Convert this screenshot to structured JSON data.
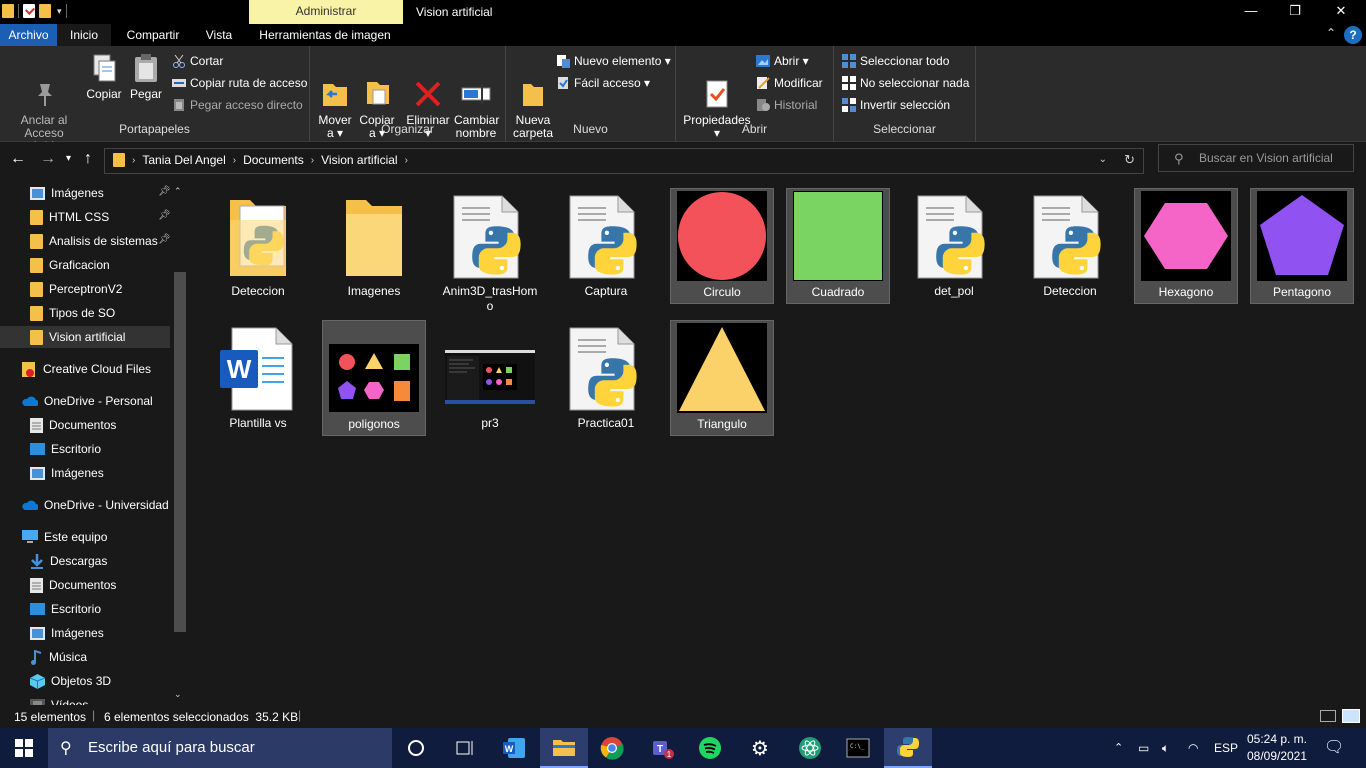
{
  "titlebar": {
    "context_tab": "Administrar",
    "window_title": "Vision artificial",
    "minimize": "—",
    "maximize": "❐",
    "close": "✕"
  },
  "ribbon_tabs": [
    "Archivo",
    "Inicio",
    "Compartir",
    "Vista",
    "Herramientas de imagen"
  ],
  "ribbon": {
    "portapapeles": {
      "label": "Portapapeles",
      "pin": "Anclar al\nAcceso rápido",
      "copy": "Copiar",
      "paste": "Pegar",
      "cut": "Cortar",
      "copy_path": "Copiar ruta de acceso",
      "paste_shortcut": "Pegar acceso directo"
    },
    "organizar": {
      "label": "Organizar",
      "move": "Mover\na ▾",
      "copy_to": "Copiar\na ▾",
      "delete": "Eliminar\n▾",
      "rename": "Cambiar\nnombre"
    },
    "nuevo": {
      "label": "Nuevo",
      "new_folder": "Nueva\ncarpeta",
      "new_item": "Nuevo elemento ▾",
      "easy_access": "Fácil acceso ▾"
    },
    "abrir": {
      "label": "Abrir",
      "properties": "Propiedades\n▾",
      "open": "Abrir ▾",
      "edit": "Modificar",
      "history": "Historial"
    },
    "seleccionar": {
      "label": "Seleccionar",
      "select_all": "Seleccionar todo",
      "select_none": "No seleccionar nada",
      "invert": "Invertir selección"
    }
  },
  "address": {
    "crumbs": [
      "Tania Del Angel",
      "Documents",
      "Vision artificial"
    ],
    "search_placeholder": "Buscar en Vision artificial"
  },
  "sidebar": [
    {
      "label": "Imágenes",
      "icon": "pictures-icon",
      "pinned": true
    },
    {
      "label": "HTML CSS",
      "icon": "folder-icon",
      "pinned": true
    },
    {
      "label": "Analisis de sistemas",
      "icon": "folder-icon",
      "pinned": true
    },
    {
      "label": "Graficacion",
      "icon": "folder-icon",
      "pinned": false
    },
    {
      "label": "PerceptronV2",
      "icon": "folder-icon",
      "pinned": false
    },
    {
      "label": "Tipos de SO",
      "icon": "folder-icon",
      "pinned": false
    },
    {
      "label": "Vision artificial",
      "icon": "folder-icon",
      "pinned": false,
      "selected": true
    },
    {
      "label": "Creative Cloud Files",
      "icon": "creative-cloud-icon",
      "pinned": false
    },
    {
      "label": "OneDrive - Personal",
      "icon": "onedrive-icon",
      "pinned": false
    },
    {
      "label": "Documentos",
      "icon": "documents-icon",
      "pinned": false
    },
    {
      "label": "Escritorio",
      "icon": "desktop-icon",
      "pinned": false
    },
    {
      "label": "Imágenes",
      "icon": "pictures-icon",
      "pinned": false
    },
    {
      "label": "OneDrive - Universidad",
      "icon": "onedrive-icon",
      "pinned": false
    },
    {
      "label": "Este equipo",
      "icon": "computer-icon",
      "pinned": false
    },
    {
      "label": "Descargas",
      "icon": "downloads-icon",
      "pinned": false
    },
    {
      "label": "Documentos",
      "icon": "documents-icon",
      "pinned": false
    },
    {
      "label": "Escritorio",
      "icon": "desktop-icon",
      "pinned": false
    },
    {
      "label": "Imágenes",
      "icon": "pictures-icon",
      "pinned": false
    },
    {
      "label": "Música",
      "icon": "music-icon",
      "pinned": false
    },
    {
      "label": "Objetos 3D",
      "icon": "3d-objects-icon",
      "pinned": false
    },
    {
      "label": "Vídeos",
      "icon": "videos-icon",
      "pinned": false
    }
  ],
  "files": [
    {
      "name": "Deteccion",
      "type": "folder-python",
      "selected": false
    },
    {
      "name": "Imagenes",
      "type": "folder",
      "selected": false
    },
    {
      "name": "Anim3D_trasHomo",
      "type": "python",
      "selected": false
    },
    {
      "name": "Captura",
      "type": "python",
      "selected": false
    },
    {
      "name": "Circulo",
      "type": "circle",
      "color": "#f4525a",
      "selected": true
    },
    {
      "name": "Cuadrado",
      "type": "square",
      "color": "#7ad461",
      "selected": true
    },
    {
      "name": "det_pol",
      "type": "python",
      "selected": false
    },
    {
      "name": "Deteccion",
      "type": "python",
      "selected": false
    },
    {
      "name": "Hexagono",
      "type": "hexagon",
      "color": "#f565c7",
      "selected": true
    },
    {
      "name": "Pentagono",
      "type": "pentagon",
      "color": "#9152f2",
      "selected": true
    },
    {
      "name": "Plantilla vs",
      "type": "word",
      "selected": false
    },
    {
      "name": "poligonos",
      "type": "polygons",
      "selected": true
    },
    {
      "name": "pr3",
      "type": "screenshot",
      "selected": false
    },
    {
      "name": "Practica01",
      "type": "python",
      "selected": false
    },
    {
      "name": "Triangulo",
      "type": "triangle",
      "color": "#fbd26a",
      "selected": true
    }
  ],
  "status": {
    "count": "15 elementos",
    "selection": "6 elementos seleccionados  35.2 KB"
  },
  "taskbar": {
    "search_placeholder": "Escribe aquí para buscar",
    "lang": "ESP",
    "time": "05:24 p. m.",
    "date": "08/09/2021"
  }
}
